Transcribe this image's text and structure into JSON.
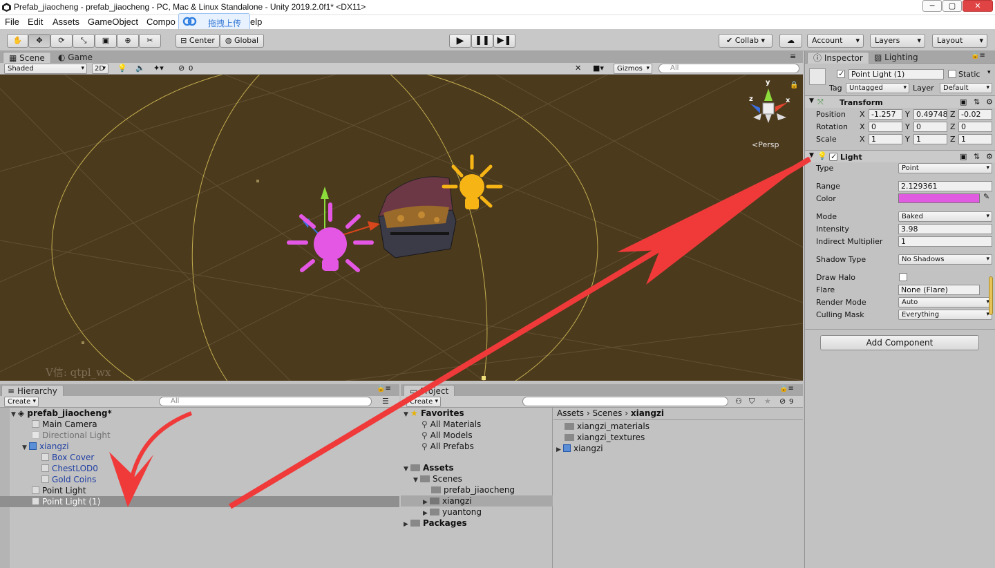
{
  "window": {
    "title": "Prefab_jiaocheng - prefab_jiaocheng - PC, Mac & Linux Standalone - Unity 2019.2.0f1* <DX11>"
  },
  "menu": [
    "File",
    "Edit",
    "Assets",
    "GameObject",
    "Compo",
    "elp"
  ],
  "upload_popup": {
    "label": "拖拽上传"
  },
  "toolbar": {
    "center": "Center",
    "global": "Global",
    "collab": "Collab",
    "account": "Account",
    "layers": "Layers",
    "layout": "Layout"
  },
  "scene_tabs": {
    "scene": "Scene",
    "game": "Game"
  },
  "scene_bar": {
    "shading": "Shaded",
    "mode2d": "2D",
    "hidden_count": "0",
    "gizmos": "Gizmos",
    "search_placeholder": "All"
  },
  "scene_view": {
    "persp": "Persp",
    "watermark": "V信: qtpl_wx",
    "gizmo_axis_y": "y",
    "gizmo_axis_x": "x",
    "gizmo_axis_z": "z"
  },
  "hierarchy": {
    "tab": "Hierarchy",
    "create": "Create",
    "search_placeholder": "All",
    "scene_name": "prefab_jiaocheng*",
    "items": [
      {
        "label": "Main Camera",
        "style": "normal"
      },
      {
        "label": "Directional Light",
        "style": "grey"
      },
      {
        "label": "xiangzi",
        "style": "blue"
      },
      {
        "label": "Box Cover",
        "style": "blue"
      },
      {
        "label": "ChestLOD0",
        "style": "blue"
      },
      {
        "label": "Gold Coins",
        "style": "blue"
      },
      {
        "label": "Point Light",
        "style": "normal"
      },
      {
        "label": "Point Light (1)",
        "style": "selected"
      }
    ]
  },
  "project": {
    "tab": "Project",
    "create": "Create",
    "hidden_count": "9",
    "favorites": "Favorites",
    "fav_items": [
      "All Materials",
      "All Models",
      "All Prefabs"
    ],
    "assets": "Assets",
    "scenes": "Scenes",
    "scene_children": [
      "prefab_jiaocheng",
      "xiangzi",
      "yuantong"
    ],
    "packages": "Packages",
    "breadcrumb": [
      "Assets",
      "Scenes",
      "xiangzi"
    ],
    "files": [
      "xiangzi_materials",
      "xiangzi_textures",
      "xiangzi"
    ]
  },
  "inspector": {
    "tabs": {
      "inspector": "Inspector",
      "lighting": "Lighting"
    },
    "object_name": "Point Light (1)",
    "static_label": "Static",
    "tag_label": "Tag",
    "tag_value": "Untagged",
    "layer_label": "Layer",
    "layer_value": "Default",
    "transform": {
      "title": "Transform",
      "position_label": "Position",
      "pos": [
        "-1.257",
        "0.49748",
        "-0.02"
      ],
      "rotation_label": "Rotation",
      "rot": [
        "0",
        "0",
        "0"
      ],
      "scale_label": "Scale",
      "scale": [
        "1",
        "1",
        "1"
      ],
      "axes": [
        "X",
        "Y",
        "Z"
      ]
    },
    "light": {
      "title": "Light",
      "type_label": "Type",
      "type": "Point",
      "range_label": "Range",
      "range": "2.129361",
      "color_label": "Color",
      "color": "#e05be0",
      "mode_label": "Mode",
      "mode": "Baked",
      "intensity_label": "Intensity",
      "intensity": "3.98",
      "indirect_label": "Indirect Multiplier",
      "indirect": "1",
      "shadow_label": "Shadow Type",
      "shadow": "No Shadows",
      "halo_label": "Draw Halo",
      "flare_label": "Flare",
      "flare": "None (Flare)",
      "render_label": "Render Mode",
      "render": "Auto",
      "culling_label": "Culling Mask",
      "culling": "Everything"
    },
    "add_component": "Add Component"
  }
}
